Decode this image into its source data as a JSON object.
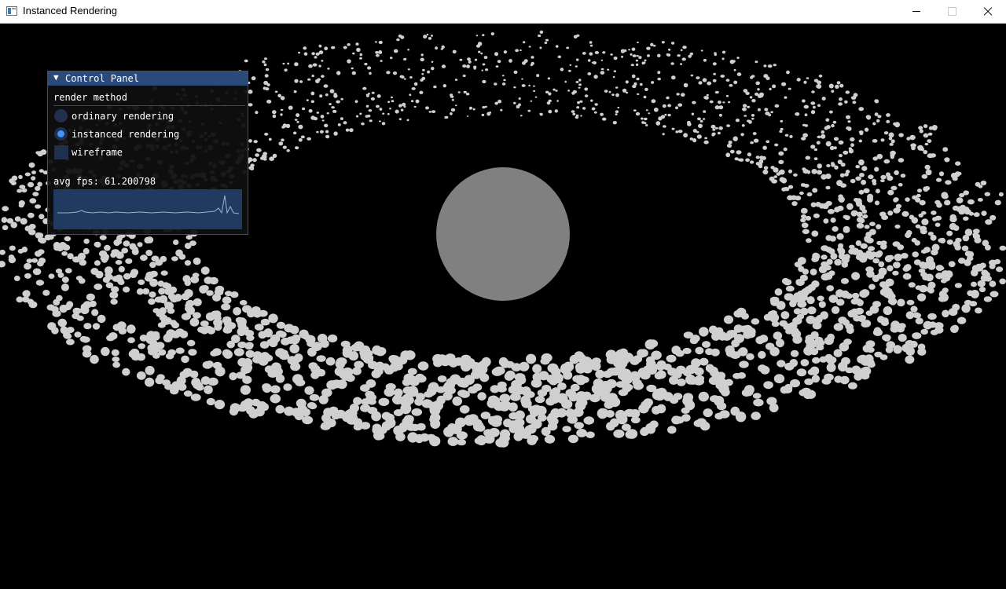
{
  "window": {
    "title": "Instanced Rendering",
    "app_icon": "window-app-icon"
  },
  "scene": {
    "planet_color": "#808080",
    "asteroid_color": "#cfcfcf",
    "background": "#000000"
  },
  "panel": {
    "title": "Control Panel",
    "section_label": "render method",
    "options": [
      {
        "label": "ordinary rendering",
        "selected": false
      },
      {
        "label": "instanced rendering",
        "selected": true
      }
    ],
    "wireframe": {
      "label": "wireframe",
      "checked": false
    },
    "fps_text": "avg fps: 61.200798",
    "accent": "#4296fa"
  }
}
